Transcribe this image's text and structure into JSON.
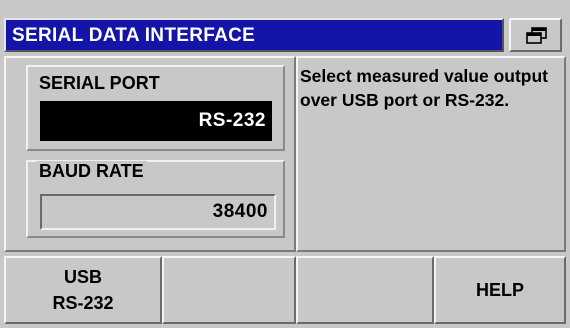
{
  "title": "SERIAL DATA INTERFACE",
  "window_icon": "window-switch-icon",
  "serial_port": {
    "label": "SERIAL PORT",
    "value": "RS-232"
  },
  "baud_rate": {
    "label": "BAUD RATE",
    "value": "38400"
  },
  "help_text": "Select measured value output over USB port or RS-232.",
  "softkeys": [
    {
      "line1": "USB",
      "line2": "RS-232"
    },
    {
      "line1": "",
      "line2": ""
    },
    {
      "line1": "",
      "line2": ""
    },
    {
      "line1": "HELP",
      "line2": ""
    }
  ]
}
